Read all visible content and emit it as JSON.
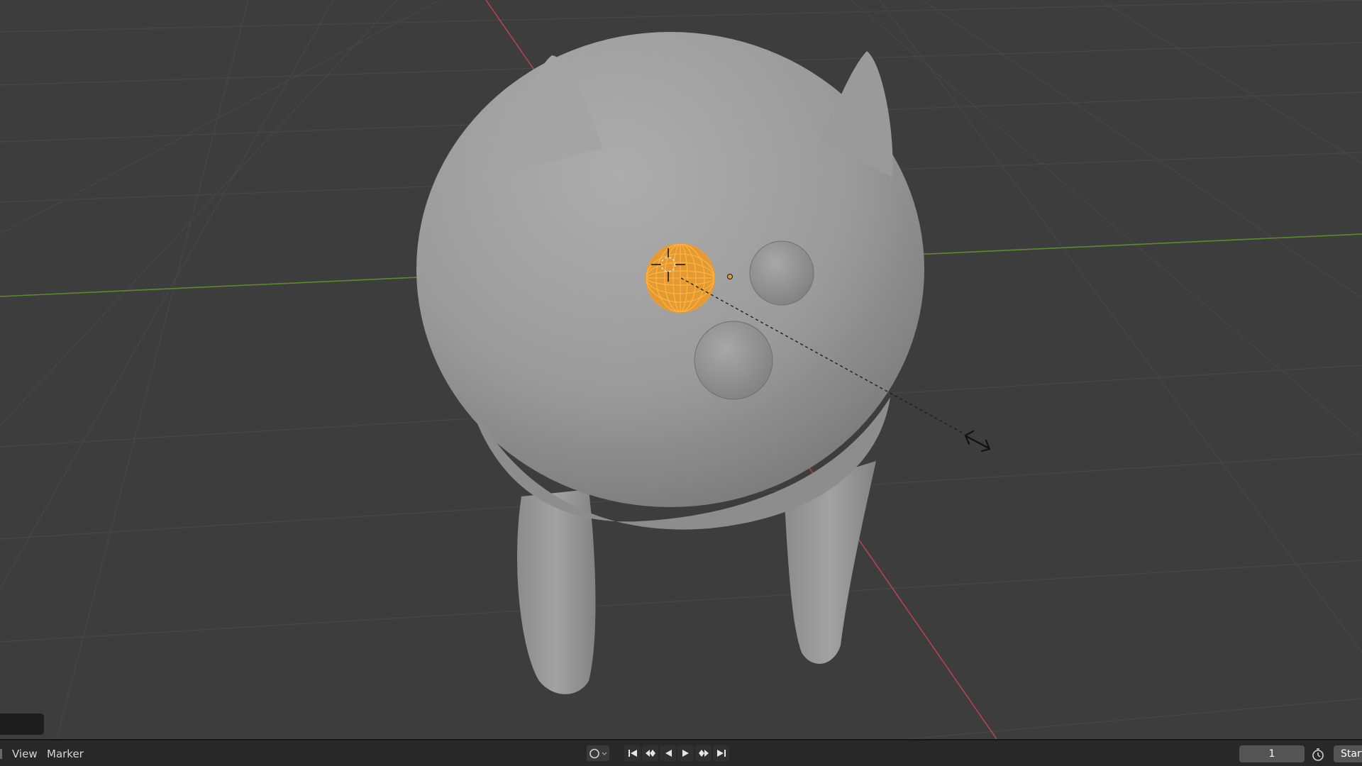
{
  "timeline": {
    "menu": {
      "view_label": "View",
      "marker_label": "Marker"
    },
    "current_frame": "1",
    "start_label": "Start"
  },
  "icons": {
    "keying": "record-circle-icon",
    "jump_start": "jump-to-start-icon",
    "prev_keyframe": "previous-keyframe-icon",
    "play_reverse": "play-reverse-icon",
    "play": "play-icon",
    "next_keyframe": "next-keyframe-icon",
    "jump_end": "jump-to-end-icon",
    "stopwatch": "stopwatch-icon",
    "scale_cursor": "scale-arrows-icon"
  },
  "colors": {
    "viewport_bg": "#3d3d3d",
    "grid": "#474747",
    "x_axis": "#b5424f",
    "y_axis": "#5f8a2c",
    "selection": "#f29a2a",
    "mesh": "#9c9c9c"
  }
}
